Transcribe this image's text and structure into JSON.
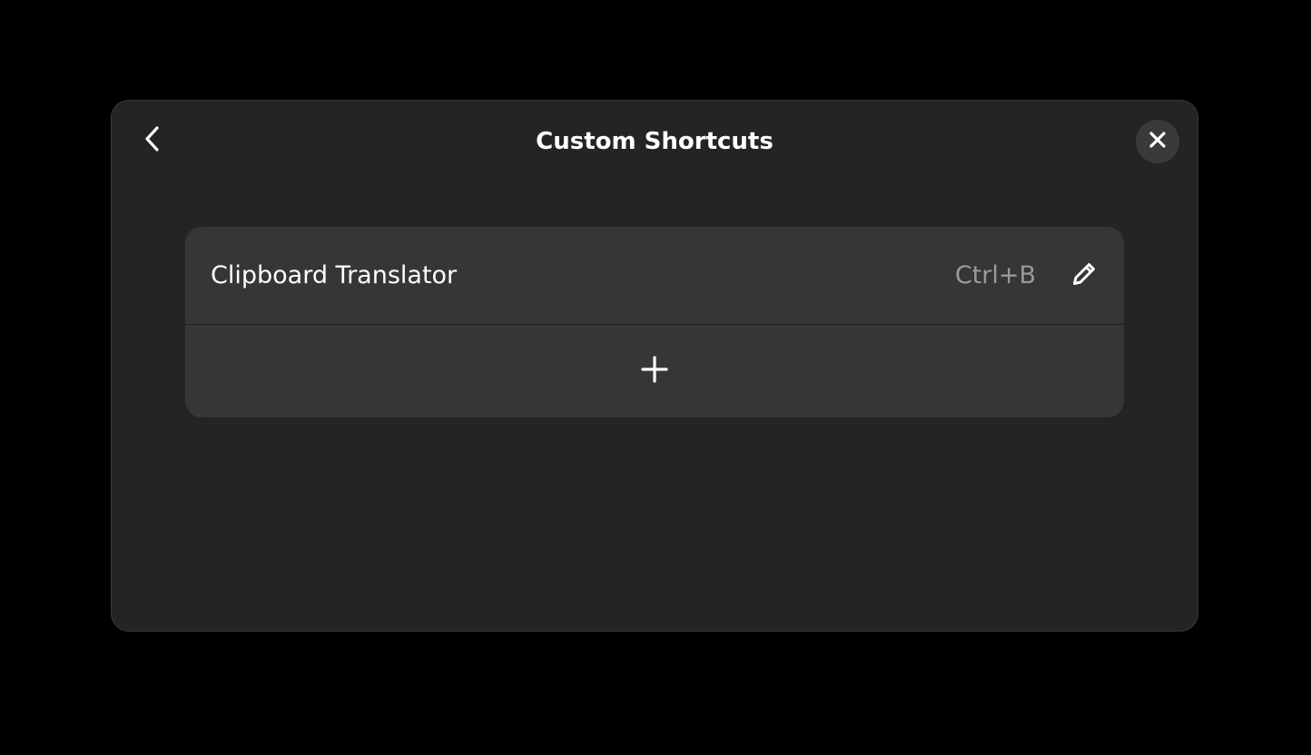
{
  "dialog": {
    "title": "Custom Shortcuts",
    "back_icon": "chevron-left-icon",
    "close_icon": "close-icon"
  },
  "shortcuts": [
    {
      "name": "Clipboard Translator",
      "accelerator": "Ctrl+B",
      "edit_icon": "pencil-icon"
    }
  ],
  "add_row": {
    "icon": "plus-icon"
  },
  "colors": {
    "background": "#000000",
    "dialog_bg": "#242424",
    "list_bg": "#363636",
    "text_primary": "#ffffff",
    "text_secondary": "#9a9a9a",
    "close_bg": "#3a3a3a"
  }
}
